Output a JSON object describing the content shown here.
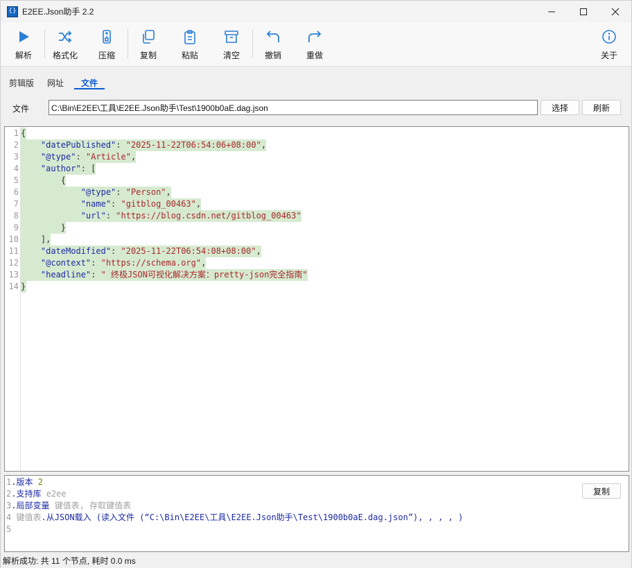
{
  "window": {
    "title": "E2EE.Json助手 2.2",
    "icon": "app-icon",
    "controls": [
      "minimize-icon",
      "maximize-icon",
      "close-icon"
    ]
  },
  "toolbar": {
    "parse": {
      "label": "解析",
      "icon": "play-icon"
    },
    "format": {
      "label": "格式化",
      "icon": "shuffle-icon"
    },
    "compress": {
      "label": "压缩",
      "icon": "compress-icon"
    },
    "copy": {
      "label": "复制",
      "icon": "copy-icon"
    },
    "paste": {
      "label": "粘贴",
      "icon": "clipboard-icon"
    },
    "clear": {
      "label": "清空",
      "icon": "archive-icon"
    },
    "undo": {
      "label": "撤销",
      "icon": "undo-icon"
    },
    "redo": {
      "label": "重做",
      "icon": "redo-icon"
    },
    "about": {
      "label": "关于",
      "icon": "info-icon"
    }
  },
  "tabs": {
    "clipboard": "剪辑版",
    "url": "网址",
    "file": "文件",
    "active": "file"
  },
  "file_row": {
    "label": "文件",
    "path": "C:\\Bin\\E2EE\\工具\\E2EE.Json助手\\Test\\1900b0aE.dag.json",
    "select_button": "选择",
    "refresh_button": "刷新"
  },
  "editor": {
    "line_numbers": [
      "1",
      "2",
      "3",
      "4",
      "5",
      "6",
      "7",
      "8",
      "9",
      "10",
      "11",
      "12",
      "13",
      "14"
    ],
    "lines": [
      {
        "segments": [
          {
            "t": "{",
            "c": "p"
          }
        ]
      },
      {
        "segments": [
          {
            "t": "    \"datePublished\"",
            "c": "k"
          },
          {
            "t": ": ",
            "c": "p"
          },
          {
            "t": "\"2025-11-22T06:54:06+08:00\"",
            "c": "s"
          },
          {
            "t": ",",
            "c": "p"
          }
        ]
      },
      {
        "segments": [
          {
            "t": "    \"@type\"",
            "c": "k"
          },
          {
            "t": ": ",
            "c": "p"
          },
          {
            "t": "\"Article\"",
            "c": "s"
          },
          {
            "t": ",",
            "c": "p"
          }
        ]
      },
      {
        "segments": [
          {
            "t": "    \"author\"",
            "c": "k"
          },
          {
            "t": ": [",
            "c": "p"
          }
        ]
      },
      {
        "segments": [
          {
            "t": "        {",
            "c": "p"
          }
        ]
      },
      {
        "segments": [
          {
            "t": "            \"@type\"",
            "c": "k"
          },
          {
            "t": ": ",
            "c": "p"
          },
          {
            "t": "\"Person\"",
            "c": "s"
          },
          {
            "t": ",",
            "c": "p"
          }
        ]
      },
      {
        "segments": [
          {
            "t": "            \"name\"",
            "c": "k"
          },
          {
            "t": ": ",
            "c": "p"
          },
          {
            "t": "\"gitblog_00463\"",
            "c": "s"
          },
          {
            "t": ",",
            "c": "p"
          }
        ]
      },
      {
        "segments": [
          {
            "t": "            \"url\"",
            "c": "k"
          },
          {
            "t": ": ",
            "c": "p"
          },
          {
            "t": "\"https://blog.csdn.net/gitblog_00463\"",
            "c": "s"
          }
        ]
      },
      {
        "segments": [
          {
            "t": "        }",
            "c": "p"
          }
        ]
      },
      {
        "segments": [
          {
            "t": "    ],",
            "c": "p"
          }
        ]
      },
      {
        "segments": [
          {
            "t": "    \"dateModified\"",
            "c": "k"
          },
          {
            "t": ": ",
            "c": "p"
          },
          {
            "t": "\"2025-11-22T06:54:08+08:00\"",
            "c": "s"
          },
          {
            "t": ",",
            "c": "p"
          }
        ]
      },
      {
        "segments": [
          {
            "t": "    \"@context\"",
            "c": "k"
          },
          {
            "t": ": ",
            "c": "p"
          },
          {
            "t": "\"https://schema.org\"",
            "c": "s"
          },
          {
            "t": ",",
            "c": "p"
          }
        ]
      },
      {
        "segments": [
          {
            "t": "    \"headline\"",
            "c": "k"
          },
          {
            "t": ": ",
            "c": "p"
          },
          {
            "t": "\" 终极JSON可视化解决方案：pretty-json完全指南\"",
            "c": "s"
          }
        ]
      },
      {
        "segments": [
          {
            "t": "}",
            "c": "p"
          }
        ]
      }
    ]
  },
  "output_pane": {
    "copy_button": "复制",
    "lines": [
      [
        {
          "t": "1",
          "c": "pn"
        },
        {
          "t": ".版本 ",
          "c": "pb"
        },
        {
          "t": "2",
          "c": "py"
        }
      ],
      [
        {
          "t": "2",
          "c": "pn"
        },
        {
          "t": ".支持库 ",
          "c": "pb"
        },
        {
          "t": "e2ee",
          "c": "pg"
        }
      ],
      [
        {
          "t": "3",
          "c": "pn"
        },
        {
          "t": ".局部变量 ",
          "c": "pb"
        },
        {
          "t": "键值表, 存取键值表",
          "c": "pg"
        }
      ],
      [
        {
          "t": "4 ",
          "c": "pn"
        },
        {
          "t": "键值表",
          "c": "pg"
        },
        {
          "t": ".从JSON载入 ",
          "c": "pb"
        },
        {
          "t": "(读入文件 (“C:\\Bin\\E2EE\\工具\\E2EE.Json助手\\Test\\1900b0aE.dag.json”), , , , )",
          "c": "pb"
        }
      ],
      [
        {
          "t": "5",
          "c": "pn"
        }
      ]
    ]
  },
  "status": {
    "text": "解析成功: 共 11 个节点, 耗时 0.0 ms"
  }
}
